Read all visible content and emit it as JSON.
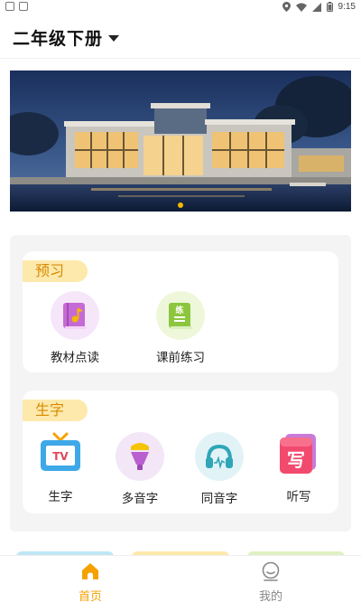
{
  "status_bar": {
    "time": "9:15"
  },
  "header": {
    "title": "二年级下册",
    "dropdown_icon": "caret-down-icon"
  },
  "banner": {
    "image": "modern villa at night with pool",
    "dots": 1,
    "active_dot": 0
  },
  "sections": [
    {
      "tag": "预习",
      "items": [
        {
          "label": "教材点读",
          "icon": "textbook-read-icon",
          "color": "#c66ad6"
        },
        {
          "label": "课前练习",
          "icon": "practice-book-icon",
          "color": "#8cc63e"
        }
      ]
    },
    {
      "tag": "生字",
      "items": [
        {
          "label": "生字",
          "icon": "tv-icon"
        },
        {
          "label": "多音字",
          "icon": "microphone-icon"
        },
        {
          "label": "同音字",
          "icon": "headphones-icon"
        },
        {
          "label": "听写",
          "icon": "write-card-icon",
          "glyph": "写"
        }
      ]
    }
  ],
  "tabbar": {
    "tabs": [
      {
        "label": "首页",
        "icon": "home-icon",
        "active": true
      },
      {
        "label": "我的",
        "icon": "profile-icon",
        "active": false
      }
    ]
  },
  "colors": {
    "accent": "#f5b800",
    "tag_bg": "#fde9ac",
    "tag_text": "#d98a00",
    "active_tab": "#f5a200",
    "inactive_tab": "#888888"
  }
}
